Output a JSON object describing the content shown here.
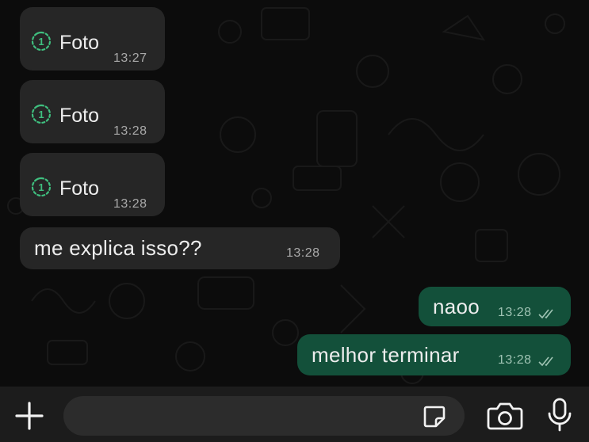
{
  "messages": [
    {
      "direction": "incoming",
      "kind": "photo",
      "label": "Foto",
      "time": "13:27"
    },
    {
      "direction": "incoming",
      "kind": "photo",
      "label": "Foto",
      "time": "13:28"
    },
    {
      "direction": "incoming",
      "kind": "photo",
      "label": "Foto",
      "time": "13:28"
    },
    {
      "direction": "incoming",
      "kind": "text",
      "text": "me explica isso??",
      "time": "13:28"
    },
    {
      "direction": "outgoing",
      "kind": "text",
      "text": "naoo",
      "time": "13:28",
      "status": "read"
    },
    {
      "direction": "outgoing",
      "kind": "text",
      "text": "melhor terminar",
      "time": "13:28",
      "status": "read"
    }
  ],
  "composer": {
    "placeholder": "",
    "icons": [
      "plus-icon",
      "sticker-icon",
      "camera-icon",
      "mic-icon"
    ]
  },
  "colors": {
    "background": "#0c0c0c",
    "incoming_bubble": "#262626",
    "outgoing_bubble": "#13503a",
    "view_once_icon": "#3fbf7f",
    "read_ticks": "#9fc3b3"
  }
}
